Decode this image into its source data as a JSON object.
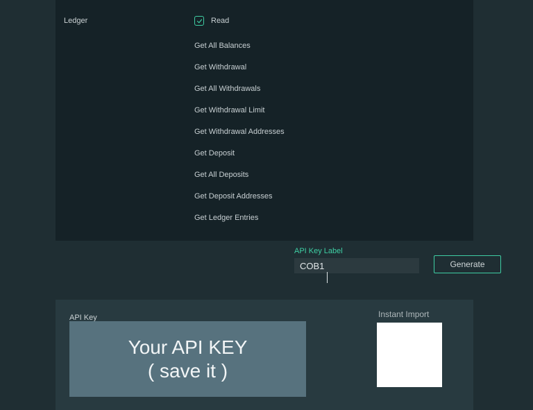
{
  "ledger": {
    "section_label": "Ledger",
    "read_label": "Read",
    "permissions": [
      "Get All Balances",
      "Get Withdrawal",
      "Get All Withdrawals",
      "Get Withdrawal Limit",
      "Get Withdrawal Addresses",
      "Get Deposit",
      "Get All Deposits",
      "Get Deposit Addresses",
      "Get Ledger Entries"
    ]
  },
  "api_key_label_field": {
    "label": "API Key Label",
    "value": "COB1"
  },
  "generate_button": "Generate",
  "api_key_panel": {
    "label": "API Key",
    "line1": "Your API KEY",
    "line2": "( save it )"
  },
  "instant_import_label": "Instant Import"
}
